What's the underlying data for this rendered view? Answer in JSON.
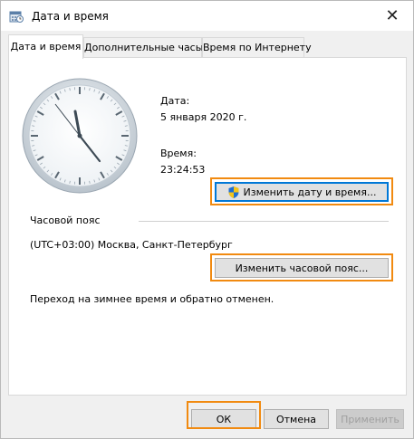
{
  "window": {
    "title": "Дата и время",
    "close_symbol": "✕",
    "title_icon": "calendar-clock-icon"
  },
  "tabs": [
    {
      "label": "Дата и время",
      "active": true
    },
    {
      "label": "Дополнительные часы",
      "active": false
    },
    {
      "label": "Время по Интернету",
      "active": false
    }
  ],
  "date": {
    "label": "Дата:",
    "value": "5 января 2020 г."
  },
  "time": {
    "label": "Время:",
    "value": "23:24:53"
  },
  "change_datetime_button": {
    "label": "Изменить дату и время...",
    "icon": "shield-icon"
  },
  "timezone": {
    "section_label": "Часовой пояс",
    "value": "(UTC+03:00) Москва, Санкт-Петербург",
    "change_button": "Изменить часовой пояс..."
  },
  "dst_note": "Переход на зимнее время и обратно отменен.",
  "footer": {
    "ok": "ОК",
    "cancel": "Отмена",
    "apply": "Применить"
  },
  "accent_colors": {
    "highlight": "#f18a10",
    "focus": "#0078d7"
  }
}
